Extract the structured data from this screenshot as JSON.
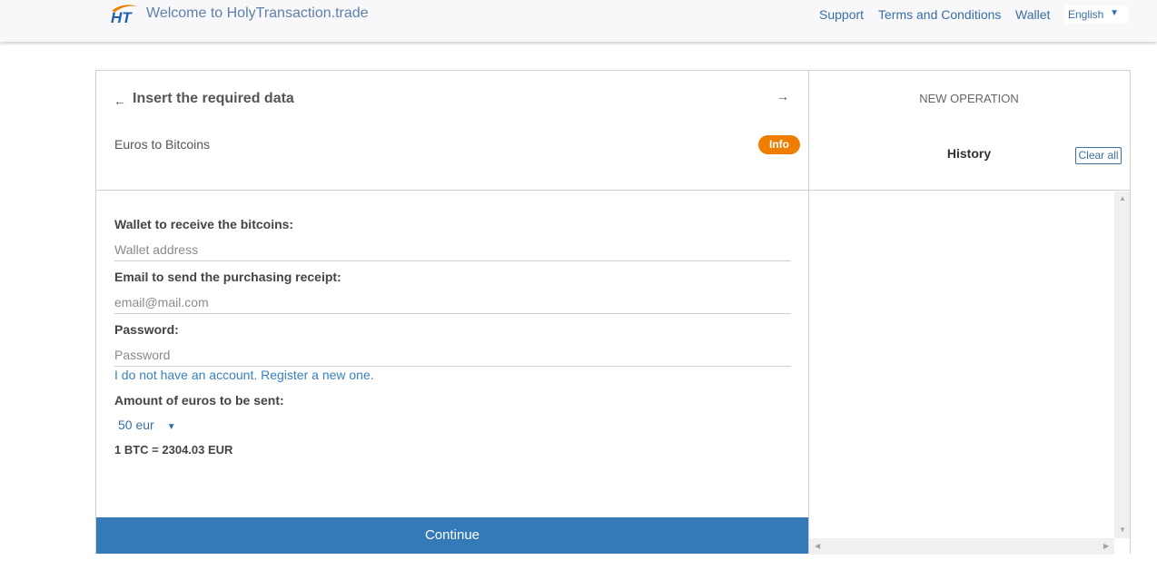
{
  "header": {
    "logo_icon": "holytransaction-logo",
    "title": "Welcome to HolyTransaction.trade",
    "nav": [
      {
        "label": "Support"
      },
      {
        "label": "Terms and Conditions"
      },
      {
        "label": "Wallet"
      }
    ],
    "language": {
      "selected": "English",
      "caret": "▼"
    }
  },
  "left_panel": {
    "back_icon": "←",
    "title": "Insert the required data",
    "forward_icon": "→",
    "subtitle": "Euros to Bitcoins",
    "info_badge": "Info",
    "form": {
      "wallet_label": "Wallet to receive the bitcoins:",
      "wallet_placeholder": "Wallet address",
      "wallet_value": "",
      "email_label": "Email to send the purchasing receipt:",
      "email_placeholder": "email@mail.com",
      "email_value": "",
      "password_label": "Password:",
      "password_placeholder": "Password",
      "password_value": "",
      "register_link": "I do not have an account. Register a new one.",
      "amount_label": "Amount of euros to be sent:",
      "amount_selected": "50 eur",
      "amount_caret": "▼",
      "rate": "1 BTC = 2304.03 EUR"
    },
    "continue_label": "Continue"
  },
  "right_panel": {
    "new_operation": "NEW OPERATION",
    "history_title": "History",
    "clear_all": "Clear all"
  },
  "colors": {
    "primary": "#347ab7",
    "accent_orange": "#ef7d00",
    "link": "#3a6ea5"
  }
}
